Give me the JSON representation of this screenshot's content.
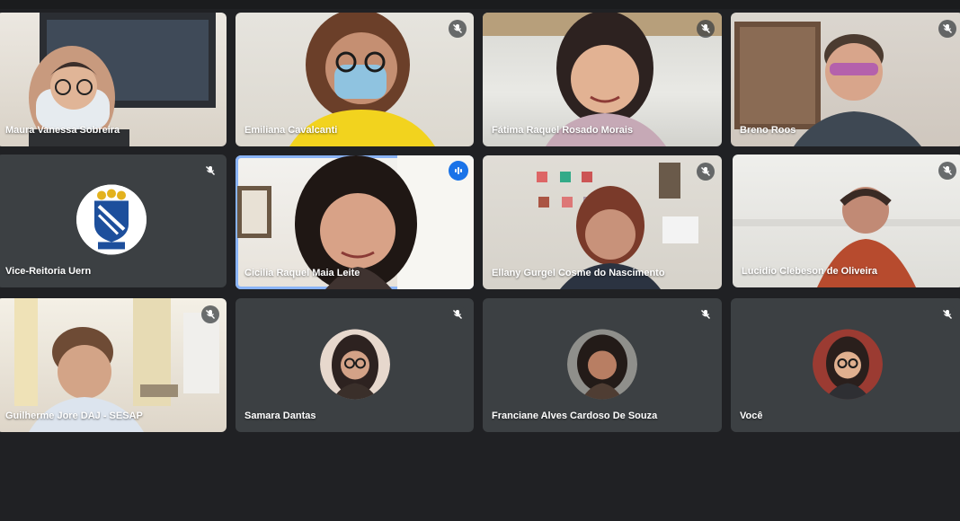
{
  "app": {
    "name": ""
  },
  "colors": {
    "background": "#202124",
    "tile": "#3c4043",
    "active_border": "#8ab4f8",
    "speaking_badge": "#1a73e8",
    "name_text": "#ffffff"
  },
  "participants": [
    {
      "name": "Maura Vanessa Sobreira",
      "muted": false,
      "camera": true
    },
    {
      "name": "Emiliana Cavalcanti",
      "muted": true,
      "camera": true
    },
    {
      "name": "Fátima Raquel Rosado Morais",
      "muted": true,
      "camera": true
    },
    {
      "name": "Breno Roos",
      "muted": true,
      "camera": true
    },
    {
      "name": "Vice-Reitoria Uern",
      "muted": true,
      "camera": false,
      "avatar": "uern-crest-icon"
    },
    {
      "name": "Cicilia Raquel Maia Leite",
      "muted": false,
      "camera": true,
      "speaking": true
    },
    {
      "name": "Ellany Gurgel Cosme do Nascimento",
      "muted": true,
      "camera": true
    },
    {
      "name": "Lucidio Clebeson de Oliveira",
      "muted": true,
      "camera": true
    },
    {
      "name": "Guilherme Jore DAJ - SESAP",
      "muted": true,
      "camera": true
    },
    {
      "name": "Samara Dantas",
      "muted": true,
      "camera": false,
      "avatar": "profile-photo"
    },
    {
      "name": "Franciane Alves Cardoso De Souza",
      "muted": true,
      "camera": false,
      "avatar": "profile-photo"
    },
    {
      "name": "Você",
      "muted": true,
      "camera": false,
      "avatar": "profile-photo"
    }
  ]
}
